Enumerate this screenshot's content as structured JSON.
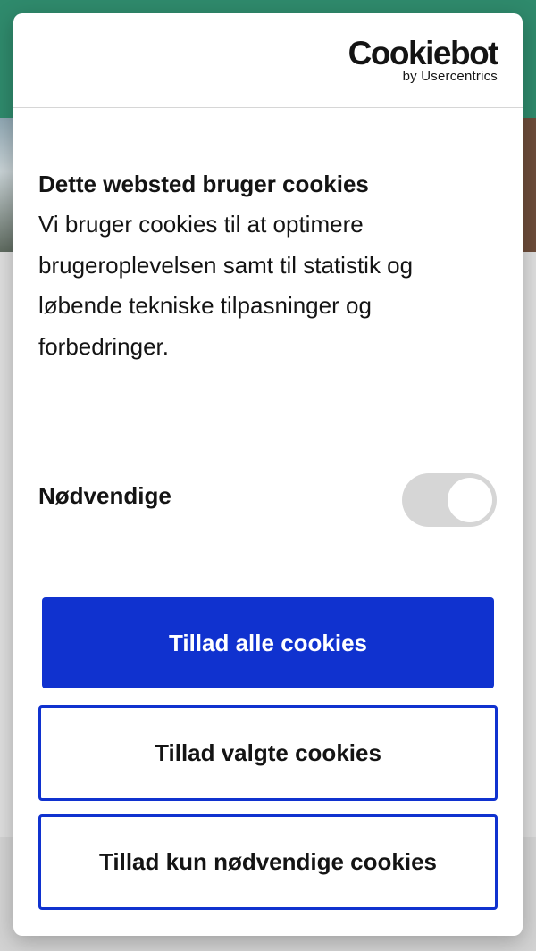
{
  "brand": {
    "name": "Cookiebot",
    "byline": "by Usercentrics"
  },
  "consent": {
    "title": "Dette websted bruger cookies",
    "description": "Vi bruger cookies til at optimere brugeroplevelsen samt til statistik og løbende tekniske tilpasninger og forbedringer.",
    "toggle_label": "Nødvendige",
    "toggle_state": "on-disabled"
  },
  "buttons": {
    "allow_all": "Tillad alle cookies",
    "allow_selected": "Tillad valgte cookies",
    "allow_necessary": "Tillad kun nødvendige cookies"
  },
  "colors": {
    "accent": "#1032cf",
    "topbar": "#2f8a6c"
  }
}
